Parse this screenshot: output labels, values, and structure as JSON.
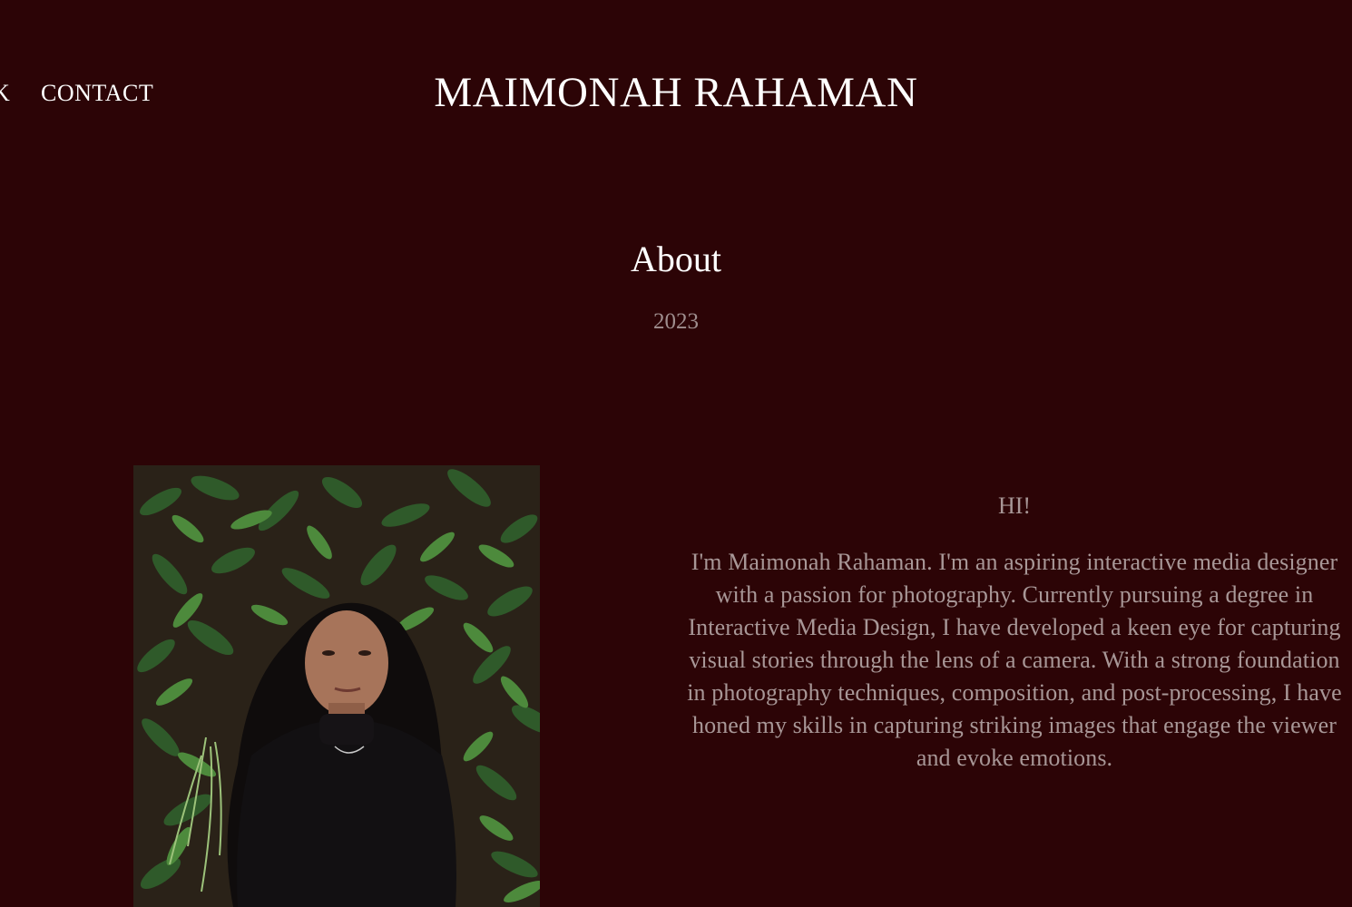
{
  "nav": {
    "clipped_label": "K",
    "contact_label": "CONTACT"
  },
  "site": {
    "title": "MAIMONAH RAHAMAN"
  },
  "page": {
    "title": "About",
    "year": "2023"
  },
  "portrait": {
    "alt": "Portrait of a woman with long dark curly hair wearing a black turtleneck in front of a wall of green plants"
  },
  "bio": {
    "greeting": "HI!",
    "text": "I'm Maimonah Rahaman. I'm an aspiring interactive media designer with a passion for photography. Currently pursuing a degree in Interactive Media Design, I have developed a keen eye for capturing visual stories through the lens of a camera. With a strong foundation in photography techniques, composition, and post-processing, I have honed my skills in capturing striking images that engage the viewer and evoke emotions."
  },
  "colors": {
    "background": "#2c0406",
    "heading": "#ffffff",
    "muted_text": "#a89797",
    "year_text": "#9f8e8e"
  }
}
